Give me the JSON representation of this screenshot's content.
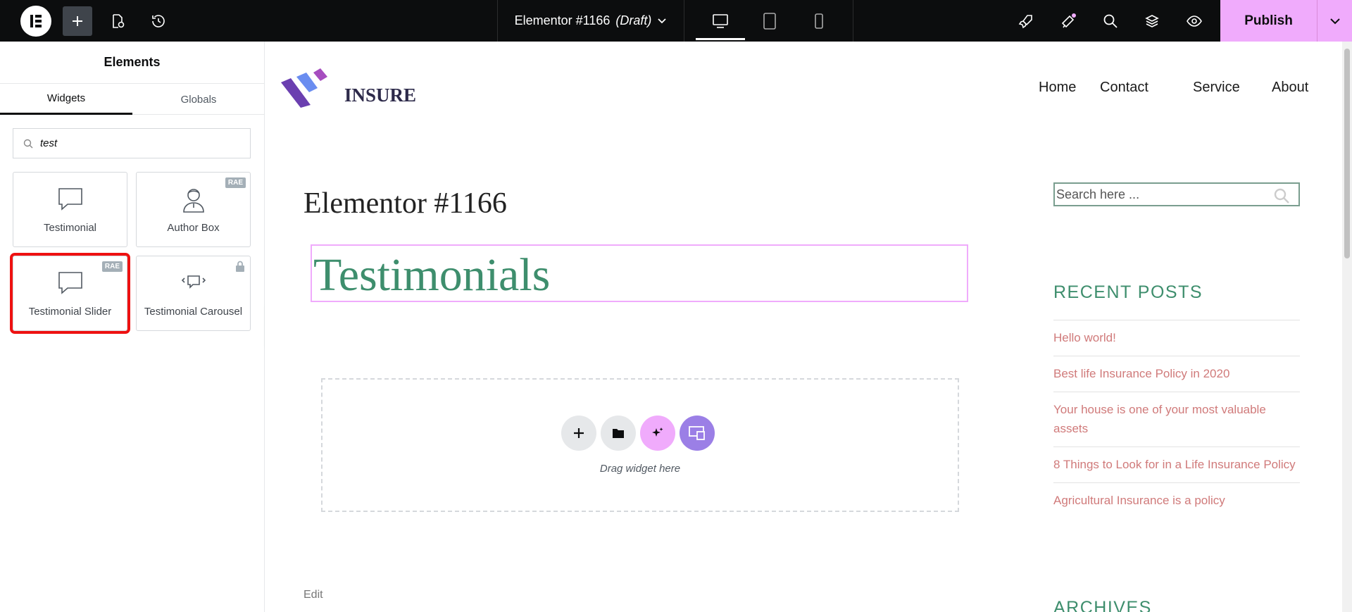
{
  "topbar": {
    "title": "Elementor #1166",
    "status": "(Draft)",
    "publish_label": "Publish"
  },
  "panel": {
    "title": "Elements",
    "tabs": [
      {
        "label": "Widgets"
      },
      {
        "label": "Globals"
      }
    ],
    "search_value": "test",
    "widgets": [
      {
        "label": "Testimonial",
        "badge": ""
      },
      {
        "label": "Author Box",
        "badge": "RAE"
      },
      {
        "label": "Testimonial Slider",
        "badge": "RAE"
      },
      {
        "label": "Testimonial Carousel",
        "badge": ""
      }
    ]
  },
  "site": {
    "logo_text": "INSURE",
    "nav": [
      "Home",
      "Contact",
      "Service",
      "About"
    ],
    "page_title": "Elementor #1166",
    "heading": "Testimonials",
    "dropzone_text": "Drag widget here",
    "edit_label": "Edit",
    "sidebar": {
      "search_placeholder": "Search here ...",
      "recent_posts_title": "RECENT POSTS",
      "posts": [
        "Hello world!",
        "Best life Insurance Policy in 2020",
        "Your house is one of your most valuable assets",
        "8 Things to Look for in a Life Insurance Policy",
        "Agricultural Insurance is a policy"
      ],
      "archives_title": "ARCHIVES"
    }
  },
  "colors": {
    "accent_pink": "#f0abfc",
    "heading_green": "#3e8e6d",
    "post_link": "#d07a7a",
    "highlight_red": "#e11111"
  }
}
